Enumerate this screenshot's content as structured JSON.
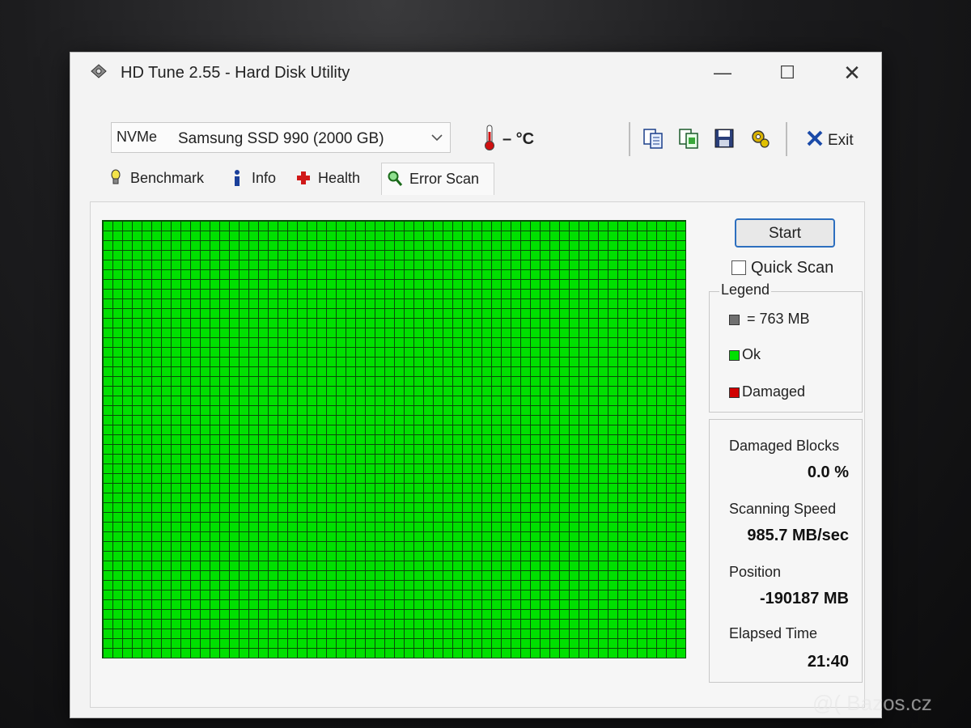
{
  "window": {
    "title": "HD Tune 2.55 - Hard Disk Utility",
    "icon": "hard-disk-icon",
    "controls": {
      "minimize": "—",
      "maximize": "☐",
      "close": "✕"
    }
  },
  "toolbar": {
    "drive_type": "NVMe",
    "drive_name": "Samsung SSD 990 (2000 GB)",
    "temperature": "– °C",
    "icons": [
      "copy-text-icon",
      "copy-screenshot-icon",
      "save-icon",
      "options-icon"
    ],
    "exit_label": "Exit"
  },
  "tabs": [
    {
      "label": "Benchmark",
      "icon": "benchmark-icon"
    },
    {
      "label": "Info",
      "icon": "info-icon"
    },
    {
      "label": "Health",
      "icon": "health-cross-icon"
    },
    {
      "label": "Error Scan",
      "icon": "magnifier-icon",
      "active": true
    }
  ],
  "scan": {
    "start_label": "Start",
    "quick_scan_label": "Quick Scan",
    "quick_scan_checked": false,
    "block_colors": {
      "ok": "#00e000",
      "damaged": "#d00000",
      "size": "#707070"
    }
  },
  "legend": {
    "title": "Legend",
    "items": [
      {
        "label": "= 763 MB",
        "color": "#707070"
      },
      {
        "label": "Ok",
        "color": "#00e000"
      },
      {
        "label": "Damaged",
        "color": "#d00000"
      }
    ]
  },
  "stats": {
    "damaged_blocks_label": "Damaged Blocks",
    "damaged_blocks_value": "0.0 %",
    "scanning_speed_label": "Scanning Speed",
    "scanning_speed_value": "985.7 MB/sec",
    "position_label": "Position",
    "position_value": "-190187 MB",
    "elapsed_time_label": "Elapsed Time",
    "elapsed_time_value": "21:40"
  },
  "watermark": "@( Bazos.cz"
}
